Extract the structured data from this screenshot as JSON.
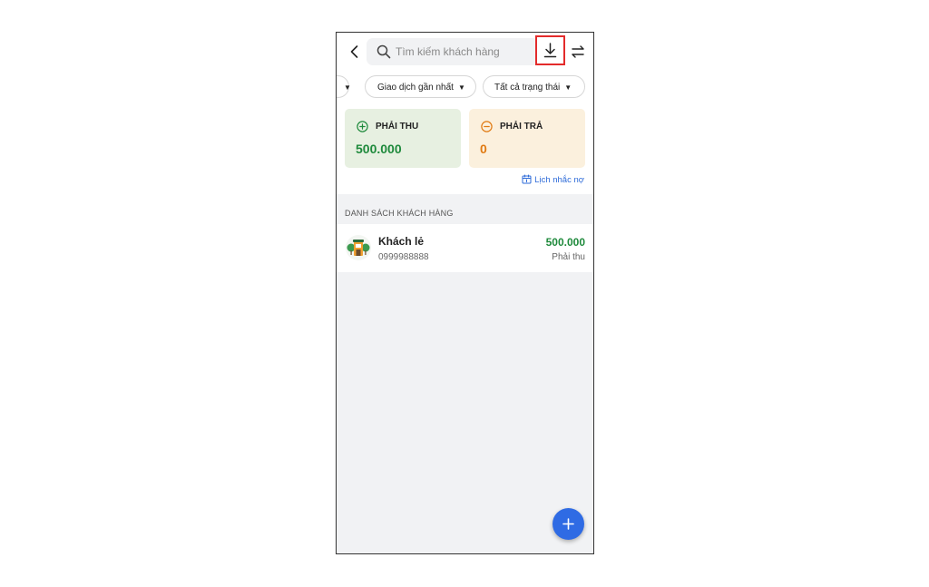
{
  "header": {
    "search_placeholder": "Tìm kiếm khách hàng",
    "icons": [
      "back-icon",
      "search-icon",
      "download-icon",
      "swap-icon"
    ]
  },
  "filters": {
    "chip_partial": "",
    "chip_transactions": "Giao dịch gần nhất",
    "chip_status": "Tất cả trạng thái"
  },
  "summary": {
    "receivable_label": "PHẢI THU",
    "receivable_value": "500.000",
    "payable_label": "PHẢI TRẢ",
    "payable_value": "0",
    "reminder_link": "Lịch nhắc nợ"
  },
  "list": {
    "section_title": "DANH SÁCH KHÁCH HÀNG",
    "customers": [
      {
        "name": "Khách lẻ",
        "phone": "0999988888",
        "amount": "500.000",
        "status": "Phải thu"
      }
    ]
  },
  "colors": {
    "accent": "#2f6be4",
    "receivable": "#1f8a3c",
    "payable": "#e07a12",
    "highlight": "#e32b2b"
  }
}
